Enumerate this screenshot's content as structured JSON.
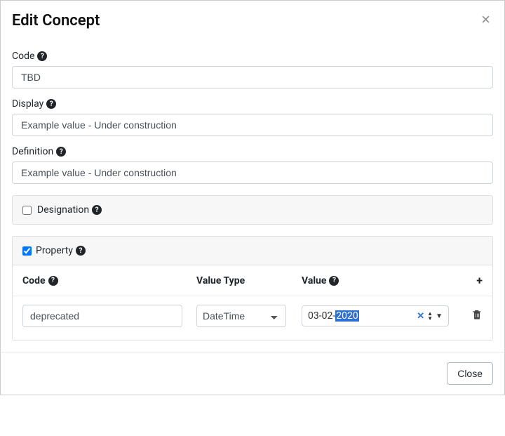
{
  "modal": {
    "title": "Edit Concept",
    "close_x": "×"
  },
  "fields": {
    "code": {
      "label": "Code",
      "value": "TBD"
    },
    "display": {
      "label": "Display",
      "value": "Example value - Under construction"
    },
    "definition": {
      "label": "Definition",
      "value": "Example value - Under construction"
    }
  },
  "designation": {
    "label": "Designation",
    "checked": false
  },
  "property": {
    "label": "Property",
    "checked": true,
    "columns": {
      "code": "Code",
      "value_type": "Value Type",
      "value": "Value"
    },
    "rows": [
      {
        "code": "deprecated",
        "value_type": "DateTime",
        "value_prefix": "03-02-",
        "value_selected": "2020"
      }
    ]
  },
  "footer": {
    "close": "Close"
  },
  "icons": {
    "help": "?",
    "add": "+",
    "clear": "✕",
    "up": "▲",
    "down": "▼",
    "open": "▼"
  }
}
